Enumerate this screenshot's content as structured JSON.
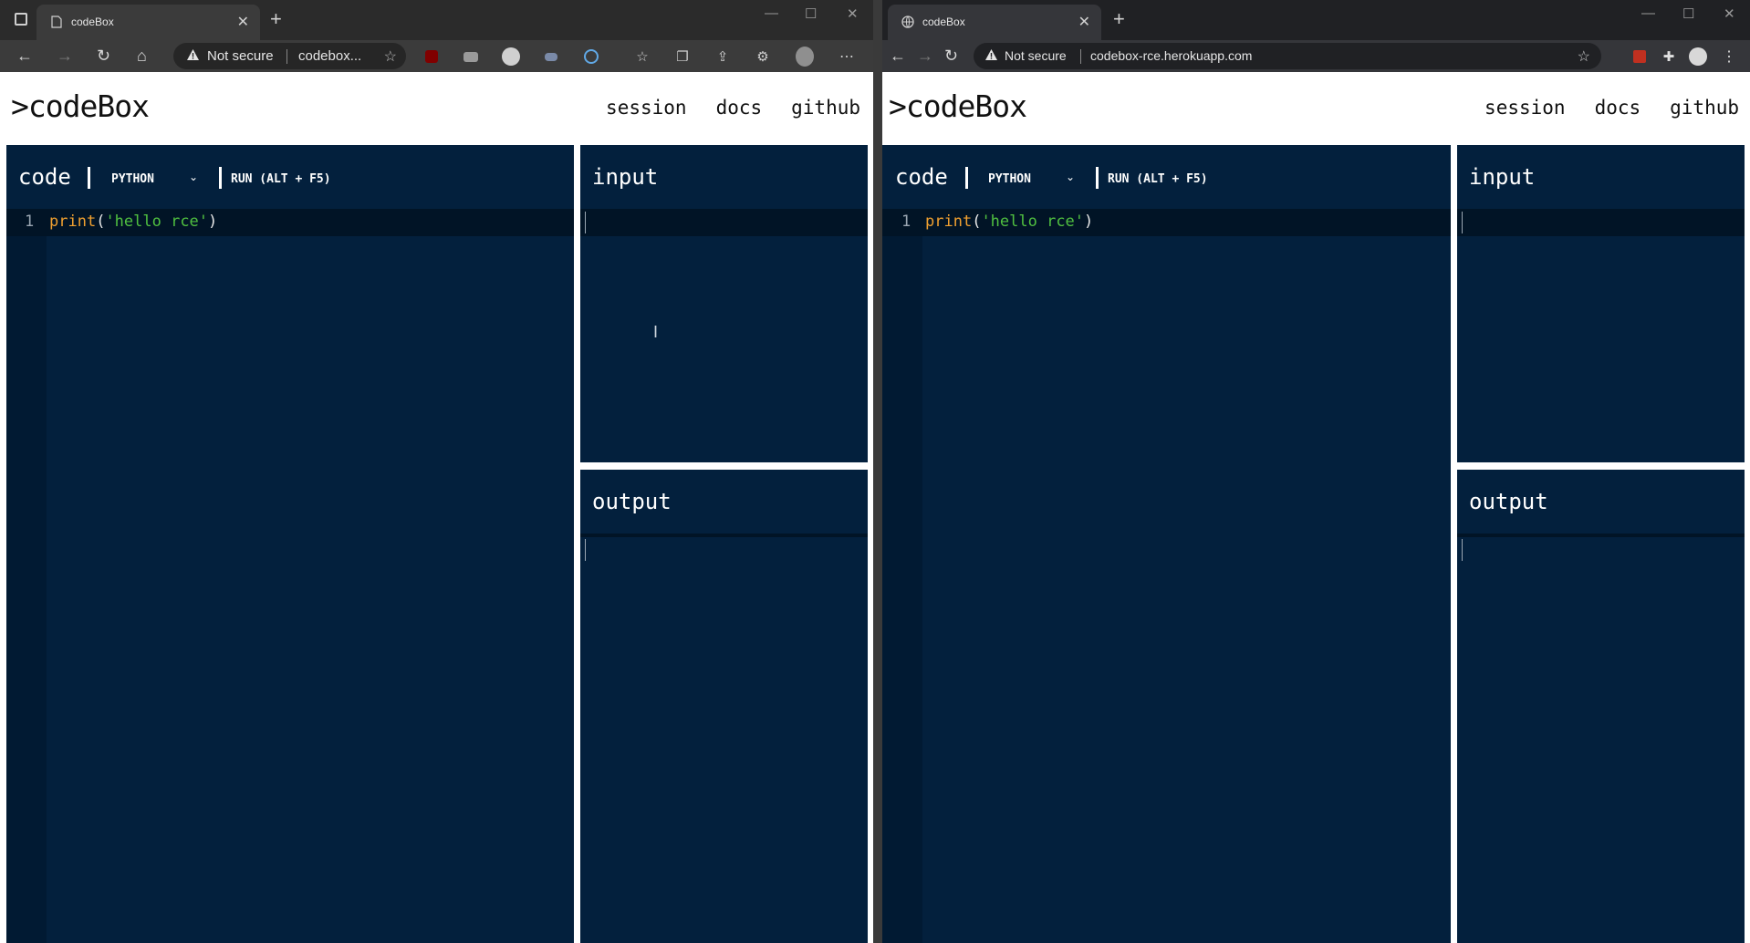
{
  "windows": [
    {
      "browser": "edge",
      "tab_title": "codeBox",
      "omnibox": {
        "security": "Not secure",
        "url": "codebox..."
      },
      "page": {
        "logo": ">codeBox",
        "nav": [
          "session",
          "docs",
          "github"
        ],
        "code_panel": {
          "title": "code",
          "language": "PYTHON",
          "run_label": "RUN (ALT + F5)",
          "line_number": "1",
          "code": {
            "fn": "print",
            "open": "(",
            "str": "'hello rce'",
            "close": ")"
          }
        },
        "input_panel": {
          "title": "input"
        },
        "output_panel": {
          "title": "output"
        }
      }
    },
    {
      "browser": "chrome",
      "tab_title": "codeBox",
      "omnibox": {
        "security": "Not secure",
        "url": "codebox-rce.herokuapp.com"
      },
      "page": {
        "logo": ">codeBox",
        "nav": [
          "session",
          "docs",
          "github"
        ],
        "code_panel": {
          "title": "code",
          "language": "PYTHON",
          "run_label": "RUN (ALT + F5)",
          "line_number": "1",
          "code": {
            "fn": "print",
            "open": "(",
            "str": "'hello rce'",
            "close": ")"
          }
        },
        "input_panel": {
          "title": "input"
        },
        "output_panel": {
          "title": "output"
        }
      }
    }
  ],
  "colors": {
    "panel_bg": "#03203d",
    "keyword": "#f0a030",
    "string": "#50c040",
    "chrome_dark": "#2b2b2b"
  },
  "icons": [
    "back-icon",
    "forward-icon",
    "reload-icon",
    "home-icon",
    "warning-icon",
    "favorite-icon",
    "extensions-icon",
    "profile-icon",
    "more-icon",
    "chevron-down-icon",
    "close-icon"
  ]
}
